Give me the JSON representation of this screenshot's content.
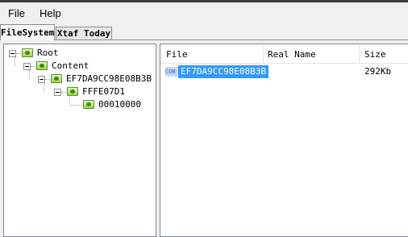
{
  "menu": {
    "file": "File",
    "help": "Help"
  },
  "tabs": [
    {
      "label": "FileSystem",
      "active": true
    },
    {
      "label": "Xtaf Today",
      "active": false
    }
  ],
  "tree": {
    "root": "Root",
    "content": "Content",
    "title_id": "EF7DA9CC98E08B3B",
    "subfolder": "FFFE07D1",
    "file_folder": "00010000"
  },
  "list": {
    "columns": {
      "file": "File",
      "real_name": "Real Name",
      "size": "Size"
    },
    "rows": [
      {
        "icon_text": "CON",
        "file": "EF7DA9CC98E08B3B",
        "real_name": "",
        "size": "292Kb",
        "selected": true
      }
    ]
  },
  "colors": {
    "selection": "#3399ff",
    "folder_green": "#9bd34a"
  }
}
